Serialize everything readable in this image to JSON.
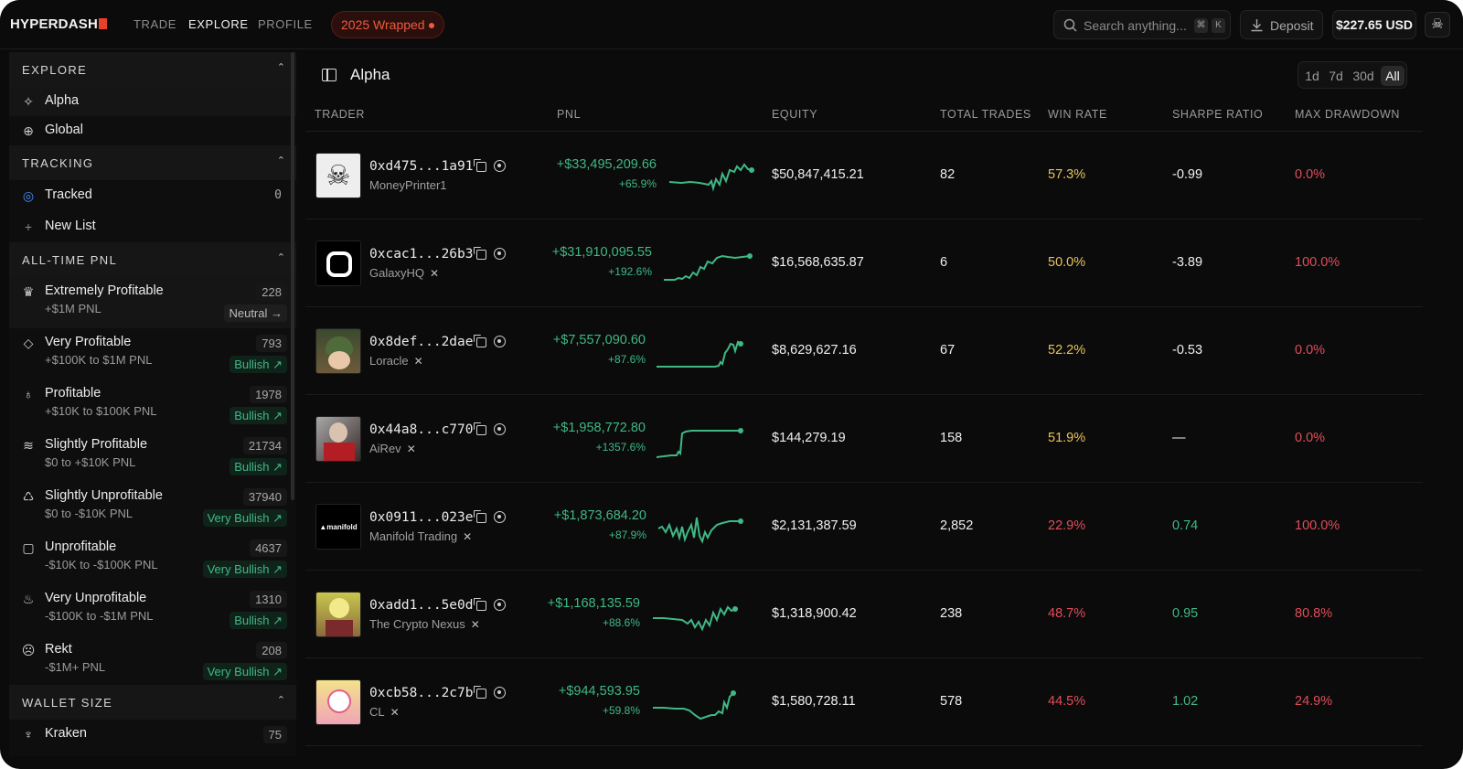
{
  "brand": {
    "logo_text": "HYPERDASH",
    "accent": "#e8412b"
  },
  "nav": {
    "trade": "TRADE",
    "explore": "EXPLORE",
    "profile": "PROFILE",
    "wrapped": "2025 Wrapped"
  },
  "topbar": {
    "search_placeholder": "Search anything...",
    "kbd1": "⌘",
    "kbd2": "K",
    "deposit": "Deposit",
    "balance": "$227.65 USD"
  },
  "sidebar": {
    "explore": {
      "title": "EXPLORE",
      "items": [
        {
          "label": "Alpha",
          "icon": "sparkle-icon"
        },
        {
          "label": "Global",
          "icon": "globe-icon"
        }
      ]
    },
    "tracking": {
      "title": "TRACKING",
      "tracked": "Tracked",
      "tracked_count": "0",
      "new_list": "New List"
    },
    "pnl": {
      "title": "ALL-TIME PNL",
      "items": [
        {
          "label": "Extremely Profitable",
          "sub": "+$1M PNL",
          "count": "228",
          "tag": "Neutral →"
        },
        {
          "label": "Very Profitable",
          "sub": "+$100K to $1M PNL",
          "count": "793",
          "tag": "Bullish ↗"
        },
        {
          "label": "Profitable",
          "sub": "+$10K to $100K PNL",
          "count": "1978",
          "tag": "Bullish ↗"
        },
        {
          "label": "Slightly Profitable",
          "sub": "$0 to +$10K PNL",
          "count": "21734",
          "tag": "Bullish ↗"
        },
        {
          "label": "Slightly Unprofitable",
          "sub": "$0 to -$10K PNL",
          "count": "37940",
          "tag": "Very Bullish ↗"
        },
        {
          "label": "Unprofitable",
          "sub": "-$10K to -$100K PNL",
          "count": "4637",
          "tag": "Very Bullish ↗"
        },
        {
          "label": "Very Unprofitable",
          "sub": "-$100K to -$1M PNL",
          "count": "1310",
          "tag": "Bullish ↗"
        },
        {
          "label": "Rekt",
          "sub": "-$1M+ PNL",
          "count": "208",
          "tag": "Very Bullish ↗"
        }
      ]
    },
    "wallet": {
      "title": "WALLET SIZE",
      "items": [
        {
          "label": "Kraken",
          "count": "75"
        }
      ]
    }
  },
  "main": {
    "title": "Alpha",
    "periods": [
      "1d",
      "7d",
      "30d",
      "All"
    ],
    "columns": {
      "trader": "TRADER",
      "pnl": "PNL",
      "equity": "EQUITY",
      "trades": "TOTAL TRADES",
      "winrate": "WIN RATE",
      "sharpe": "SHARPE RATIO",
      "drawdown": "MAX DRAWDOWN"
    },
    "rows": [
      {
        "address": "0xd475...1a91",
        "name": "MoneyPrinter1",
        "pnl": "+$33,495,209.66",
        "pnl_pct": "+65.9%",
        "equity": "$50,847,415.21",
        "trades": "82",
        "winrate": "57.3%",
        "sharpe": "-0.99",
        "drawdown": "0.0%"
      },
      {
        "address": "0xcac1...26b3",
        "name": "GalaxyHQ",
        "pnl": "+$31,910,095.55",
        "pnl_pct": "+192.6%",
        "equity": "$16,568,635.87",
        "trades": "6",
        "winrate": "50.0%",
        "sharpe": "-3.89",
        "drawdown": "100.0%"
      },
      {
        "address": "0x8def...2dae",
        "name": "Loracle",
        "pnl": "+$7,557,090.60",
        "pnl_pct": "+87.6%",
        "equity": "$8,629,627.16",
        "trades": "67",
        "winrate": "52.2%",
        "sharpe": "-0.53",
        "drawdown": "0.0%"
      },
      {
        "address": "0x44a8...c770",
        "name": "AiRev",
        "pnl": "+$1,958,772.80",
        "pnl_pct": "+1357.6%",
        "equity": "$144,279.19",
        "trades": "158",
        "winrate": "51.9%",
        "sharpe": "—",
        "drawdown": "0.0%"
      },
      {
        "address": "0x0911...023e",
        "name": "Manifold Trading",
        "pnl": "+$1,873,684.20",
        "pnl_pct": "+87.9%",
        "equity": "$2,131,387.59",
        "trades": "2,852",
        "winrate": "22.9%",
        "sharpe": "0.74",
        "drawdown": "100.0%"
      },
      {
        "address": "0xadd1...5e0d",
        "name": "The Crypto Nexus",
        "pnl": "+$1,168,135.59",
        "pnl_pct": "+88.6%",
        "equity": "$1,318,900.42",
        "trades": "238",
        "winrate": "48.7%",
        "sharpe": "0.95",
        "drawdown": "80.8%"
      },
      {
        "address": "0xcb58...2c7b",
        "name": "CL",
        "pnl": "+$944,593.95",
        "pnl_pct": "+59.8%",
        "equity": "$1,580,728.11",
        "trades": "578",
        "winrate": "44.5%",
        "sharpe": "1.02",
        "drawdown": "24.9%"
      }
    ]
  },
  "colors": {
    "positive": "#3fb886",
    "negative": "#e04d5a",
    "warning": "#e8c25a",
    "background": "#0b0b0b"
  }
}
